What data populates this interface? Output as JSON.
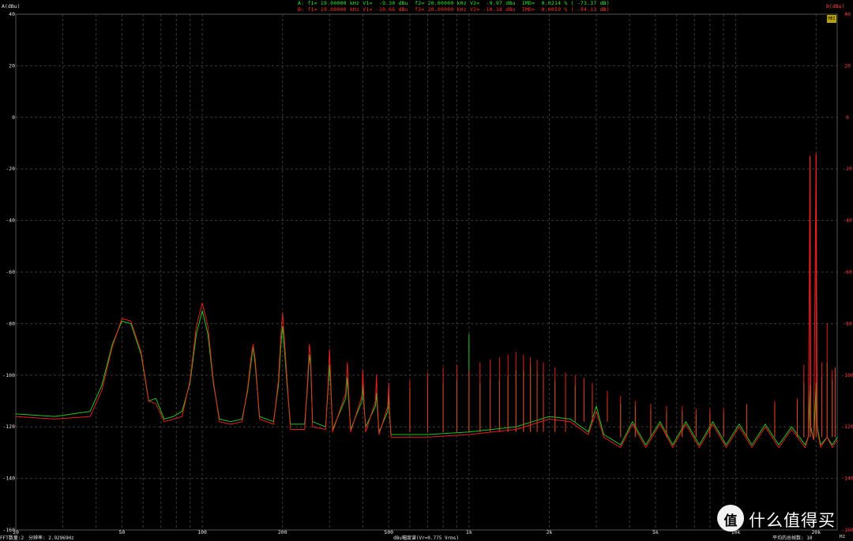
{
  "header": {
    "line_a": "A: f1= 19.00000 kHz V1=  -9.30 dBu  f2= 20.00000 kHz V2=  -9.97 dBu  IMD=  0.0214 % ( -73.37 dB)",
    "line_b": "B: f1= 19.00000 kHz V1= -10.66 dBu  f2= 20.00000 kHz V2= -10.18 dBu  IMD=  0.0059 % ( -94.13 dB)",
    "unit_left": "A(dBu)",
    "unit_right": "B(dBu)",
    "badge": "MEI"
  },
  "footer": {
    "fft_label": "FFT数量:2",
    "resolution": "分辨率: 2.92969Hz",
    "axis_title": "dBu幅度谱(Vr=0.775 Vrms)",
    "averages": "平均的总帧数: 10",
    "hz_unit": "Hz"
  },
  "watermark": {
    "logo_glyph": "值",
    "text": "什么值得买"
  },
  "colors": {
    "background": "#000000",
    "grid": "#3a3a3a",
    "series_a": "#22dd22",
    "series_b": "#ff2020",
    "axis_left_text": "#e0e0e0",
    "axis_right_text": "#ff4040"
  },
  "chart_data": {
    "type": "line",
    "x_scale": "log",
    "xlim": [
      20,
      24000
    ],
    "ylim": [
      -160,
      40
    ],
    "grid": true,
    "y_ticks": [
      40,
      20,
      0,
      -20,
      -40,
      -60,
      -80,
      -100,
      -120,
      -140,
      -160
    ],
    "x_ticks": [
      {
        "value": 20,
        "label": "20"
      },
      {
        "value": 50,
        "label": "50"
      },
      {
        "value": 100,
        "label": "100"
      },
      {
        "value": 200,
        "label": "200"
      },
      {
        "value": 500,
        "label": "500"
      },
      {
        "value": 1000,
        "label": "1k"
      },
      {
        "value": 2000,
        "label": "2k"
      },
      {
        "value": 5000,
        "label": "5k"
      },
      {
        "value": 10000,
        "label": "10k"
      },
      {
        "value": 20000,
        "label": "20k"
      }
    ],
    "series": [
      {
        "name": "A",
        "color": "#22dd22",
        "points": [
          [
            20,
            -115
          ],
          [
            28,
            -116
          ],
          [
            38,
            -114
          ],
          [
            42,
            -104
          ],
          [
            46,
            -88
          ],
          [
            50,
            -79
          ],
          [
            54,
            -80
          ],
          [
            59,
            -92
          ],
          [
            63,
            -110
          ],
          [
            67,
            -109
          ],
          [
            72,
            -117
          ],
          [
            78,
            -116
          ],
          [
            84,
            -114
          ],
          [
            90,
            -103
          ],
          [
            95,
            -84
          ],
          [
            100,
            -75
          ],
          [
            105,
            -84
          ],
          [
            110,
            -103
          ],
          [
            116,
            -117
          ],
          [
            128,
            -118
          ],
          [
            141,
            -117
          ],
          [
            148,
            -106
          ],
          [
            152,
            -96
          ],
          [
            155,
            -89
          ],
          [
            158,
            -96
          ],
          [
            164,
            -116
          ],
          [
            185,
            -118
          ],
          [
            193,
            -104
          ],
          [
            197,
            -89
          ],
          [
            200,
            -81
          ],
          [
            203,
            -89
          ],
          [
            208,
            -104
          ],
          [
            214,
            -119
          ],
          [
            242,
            -119
          ],
          [
            248,
            -105
          ],
          [
            252,
            -92
          ],
          [
            255,
            -96
          ],
          [
            259,
            -118
          ],
          [
            290,
            -120
          ],
          [
            296,
            -106
          ],
          [
            300,
            -96
          ],
          [
            303,
            -104
          ],
          [
            308,
            -121
          ],
          [
            345,
            -109
          ],
          [
            350,
            -101
          ],
          [
            354,
            -110
          ],
          [
            360,
            -121
          ],
          [
            397,
            -110
          ],
          [
            400,
            -104
          ],
          [
            404,
            -112
          ],
          [
            410,
            -120
          ],
          [
            446,
            -112
          ],
          [
            450,
            -107
          ],
          [
            454,
            -114
          ],
          [
            460,
            -122
          ],
          [
            496,
            -114
          ],
          [
            500,
            -108
          ],
          [
            504,
            -116
          ],
          [
            510,
            -123
          ],
          [
            700,
            -123
          ],
          [
            1000,
            -122
          ],
          [
            1500,
            -120
          ],
          [
            2000,
            -116
          ],
          [
            2400,
            -117
          ],
          [
            2800,
            -122
          ],
          [
            3000,
            -112
          ],
          [
            3200,
            -123
          ],
          [
            3700,
            -127
          ],
          [
            4100,
            -118
          ],
          [
            4600,
            -127
          ],
          [
            5200,
            -118
          ],
          [
            5800,
            -127
          ],
          [
            6500,
            -118
          ],
          [
            7300,
            -127
          ],
          [
            8200,
            -118
          ],
          [
            9200,
            -127
          ],
          [
            10300,
            -119
          ],
          [
            11500,
            -127
          ],
          [
            12900,
            -119
          ],
          [
            14500,
            -127
          ],
          [
            16200,
            -120
          ],
          [
            18200,
            -127
          ],
          [
            18700,
            -124
          ],
          [
            19000,
            -104
          ],
          [
            19100,
            -120
          ],
          [
            19600,
            -125
          ],
          [
            20000,
            -103
          ],
          [
            20200,
            -120
          ],
          [
            20800,
            -127
          ],
          [
            22000,
            -124
          ],
          [
            23000,
            -127
          ],
          [
            24000,
            -124
          ]
        ],
        "peaks": [
          [
            600,
            -105
          ],
          [
            700,
            -104
          ],
          [
            800,
            -103
          ],
          [
            900,
            -102
          ],
          [
            1000,
            -84
          ],
          [
            1100,
            -103
          ],
          [
            1200,
            -101
          ],
          [
            1300,
            -102
          ],
          [
            1400,
            -100
          ],
          [
            1500,
            -98
          ],
          [
            1600,
            -98
          ],
          [
            1700,
            -96
          ],
          [
            1800,
            -98
          ],
          [
            1900,
            -100
          ],
          [
            2100,
            -102
          ],
          [
            2300,
            -103
          ],
          [
            2500,
            -104
          ],
          [
            2700,
            -105
          ],
          [
            2900,
            -106
          ],
          [
            3300,
            -109
          ],
          [
            3700,
            -111
          ],
          [
            4200,
            -112
          ],
          [
            4800,
            -113
          ],
          [
            5500,
            -114
          ],
          [
            6300,
            -114
          ],
          [
            7100,
            -115
          ],
          [
            8000,
            -115
          ],
          [
            9000,
            -115
          ],
          [
            11000,
            -112
          ],
          [
            14000,
            -111
          ],
          [
            17000,
            -110
          ],
          [
            18000,
            -103
          ],
          [
            19000,
            -104
          ],
          [
            20000,
            -103
          ],
          [
            21000,
            -101
          ],
          [
            22000,
            -95
          ],
          [
            23000,
            -102
          ],
          [
            23600,
            -97
          ]
        ]
      },
      {
        "name": "B",
        "color": "#ff2020",
        "points": [
          [
            20,
            -116
          ],
          [
            28,
            -117
          ],
          [
            38,
            -116
          ],
          [
            42,
            -106
          ],
          [
            46,
            -89
          ],
          [
            50,
            -78
          ],
          [
            54,
            -79
          ],
          [
            59,
            -91
          ],
          [
            63,
            -110
          ],
          [
            67,
            -111
          ],
          [
            72,
            -118
          ],
          [
            78,
            -117
          ],
          [
            84,
            -116
          ],
          [
            90,
            -102
          ],
          [
            95,
            -81
          ],
          [
            100,
            -72
          ],
          [
            105,
            -81
          ],
          [
            110,
            -102
          ],
          [
            116,
            -118
          ],
          [
            128,
            -119
          ],
          [
            141,
            -118
          ],
          [
            148,
            -105
          ],
          [
            152,
            -94
          ],
          [
            155,
            -88
          ],
          [
            158,
            -94
          ],
          [
            164,
            -117
          ],
          [
            185,
            -119
          ],
          [
            193,
            -102
          ],
          [
            197,
            -85
          ],
          [
            200,
            -76
          ],
          [
            203,
            -85
          ],
          [
            208,
            -102
          ],
          [
            214,
            -121
          ],
          [
            242,
            -121
          ],
          [
            248,
            -103
          ],
          [
            252,
            -88
          ],
          [
            255,
            -93
          ],
          [
            259,
            -120
          ],
          [
            290,
            -121
          ],
          [
            296,
            -104
          ],
          [
            300,
            -90
          ],
          [
            303,
            -101
          ],
          [
            308,
            -122
          ],
          [
            345,
            -107
          ],
          [
            350,
            -95
          ],
          [
            354,
            -107
          ],
          [
            360,
            -122
          ],
          [
            397,
            -108
          ],
          [
            400,
            -98
          ],
          [
            404,
            -110
          ],
          [
            410,
            -122
          ],
          [
            446,
            -110
          ],
          [
            450,
            -100
          ],
          [
            454,
            -112
          ],
          [
            460,
            -123
          ],
          [
            496,
            -112
          ],
          [
            500,
            -103
          ],
          [
            504,
            -114
          ],
          [
            510,
            -124
          ],
          [
            700,
            -124
          ],
          [
            1000,
            -123
          ],
          [
            1500,
            -121
          ],
          [
            2000,
            -117
          ],
          [
            2400,
            -118
          ],
          [
            2800,
            -123
          ],
          [
            3000,
            -114
          ],
          [
            3200,
            -124
          ],
          [
            3700,
            -128
          ],
          [
            4100,
            -119
          ],
          [
            4600,
            -128
          ],
          [
            5200,
            -119
          ],
          [
            5800,
            -128
          ],
          [
            6500,
            -119
          ],
          [
            7300,
            -128
          ],
          [
            8200,
            -119
          ],
          [
            9200,
            -128
          ],
          [
            10300,
            -120
          ],
          [
            11500,
            -128
          ],
          [
            12900,
            -120
          ],
          [
            14500,
            -128
          ],
          [
            16200,
            -121
          ],
          [
            18200,
            -128
          ],
          [
            18700,
            -124
          ],
          [
            19000,
            -15
          ],
          [
            19100,
            -121
          ],
          [
            19600,
            -125
          ],
          [
            20000,
            -14
          ],
          [
            20200,
            -121
          ],
          [
            20800,
            -128
          ],
          [
            22000,
            -124
          ],
          [
            23000,
            -128
          ],
          [
            24000,
            -125
          ]
        ],
        "peaks": [
          [
            600,
            -102
          ],
          [
            700,
            -99
          ],
          [
            800,
            -97
          ],
          [
            900,
            -96
          ],
          [
            1000,
            -98
          ],
          [
            1100,
            -95
          ],
          [
            1200,
            -94
          ],
          [
            1300,
            -93
          ],
          [
            1400,
            -92
          ],
          [
            1500,
            -91
          ],
          [
            1600,
            -92
          ],
          [
            1700,
            -93
          ],
          [
            1800,
            -94
          ],
          [
            1900,
            -95
          ],
          [
            2100,
            -97
          ],
          [
            2300,
            -99
          ],
          [
            2500,
            -100
          ],
          [
            2700,
            -101
          ],
          [
            2900,
            -103
          ],
          [
            3300,
            -106
          ],
          [
            3700,
            -108
          ],
          [
            4200,
            -110
          ],
          [
            4800,
            -111
          ],
          [
            5500,
            -112
          ],
          [
            6300,
            -112
          ],
          [
            7100,
            -113
          ],
          [
            8000,
            -113
          ],
          [
            9000,
            -113
          ],
          [
            11000,
            -111
          ],
          [
            14000,
            -110
          ],
          [
            17000,
            -109
          ],
          [
            18000,
            -96
          ],
          [
            19000,
            -15
          ],
          [
            20000,
            -14
          ],
          [
            21000,
            -95
          ],
          [
            22000,
            -80
          ],
          [
            23000,
            -98
          ],
          [
            23600,
            -97
          ]
        ]
      }
    ]
  }
}
